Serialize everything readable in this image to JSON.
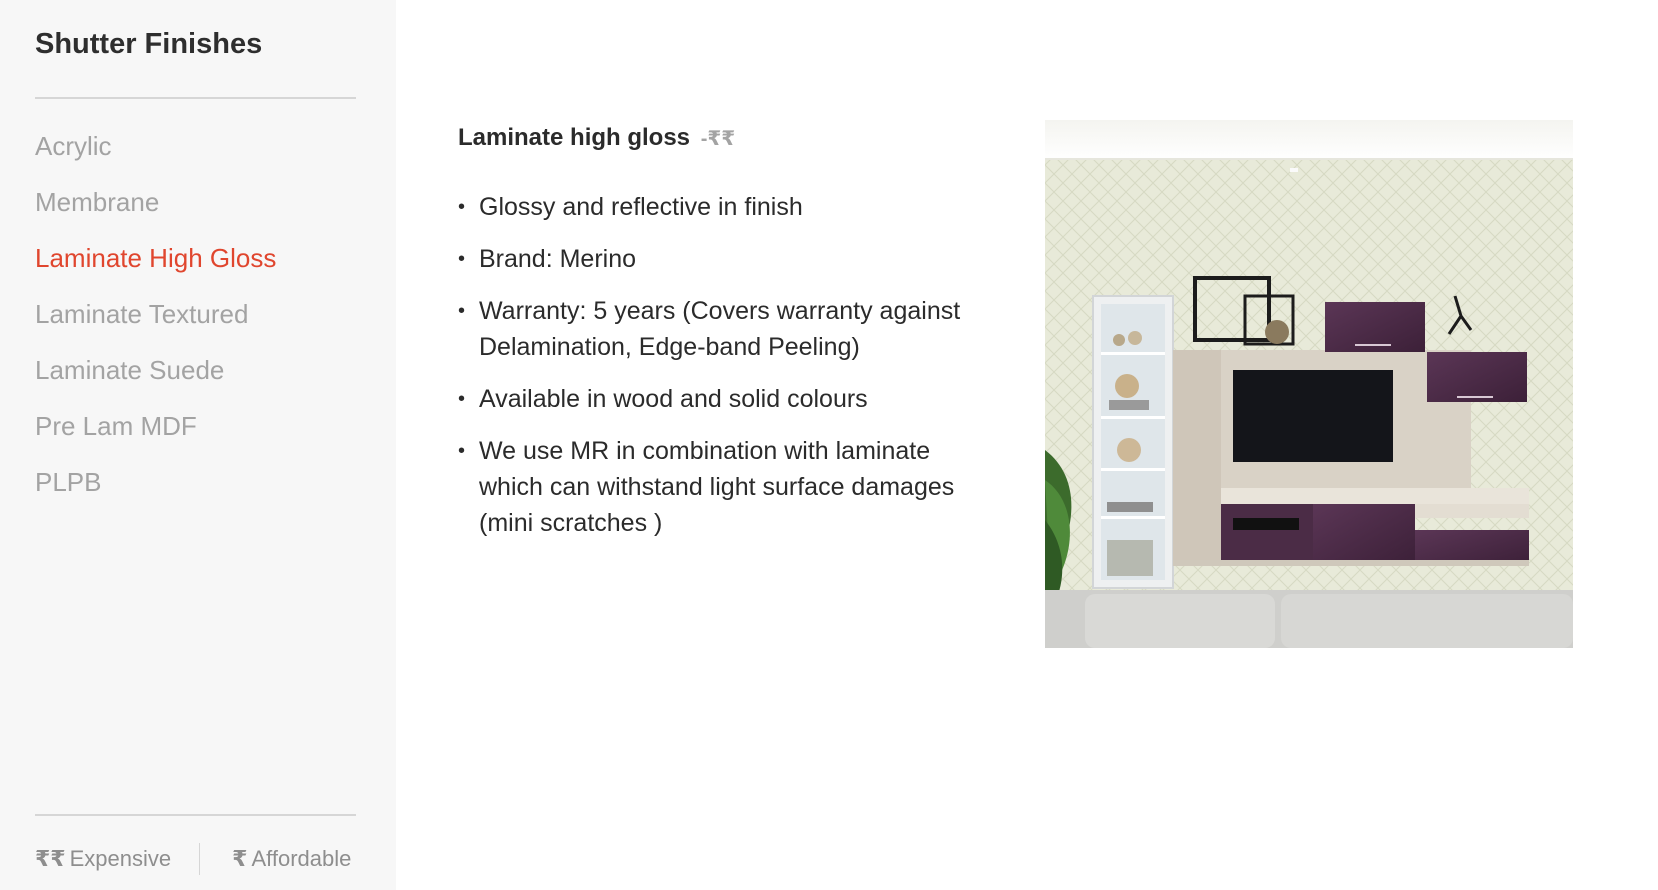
{
  "sidebar": {
    "title": "Shutter Finishes",
    "items": [
      {
        "label": "Acrylic",
        "active": false
      },
      {
        "label": "Membrane",
        "active": false
      },
      {
        "label": "Laminate High Gloss",
        "active": true
      },
      {
        "label": "Laminate Textured",
        "active": false
      },
      {
        "label": "Laminate Suede",
        "active": false
      },
      {
        "label": "Pre Lam MDF",
        "active": false
      },
      {
        "label": "PLPB",
        "active": false
      }
    ],
    "legend": {
      "expensive_symbol": "₹₹",
      "expensive_label": "Expensive",
      "affordable_symbol": "₹",
      "affordable_label": "Affordable"
    }
  },
  "main": {
    "title": "Laminate high gloss",
    "price_tag": "-₹₹",
    "features": [
      "Glossy and reflective in finish",
      "Brand: Merino",
      "Warranty: 5 years (Covers warranty against Delamination, Edge-band Peeling)",
      "Available in wood and solid colours",
      "We use MR in combination with laminate which can withstand light surface damages (mini scratches )"
    ],
    "image": {
      "icon": "tv-unit-photo"
    }
  },
  "colors": {
    "accent": "#e0462e",
    "inactive_text": "#a3a3a3",
    "sidebar_bg": "#f7f7f7",
    "cabinet_purple": "#4a2a45"
  }
}
